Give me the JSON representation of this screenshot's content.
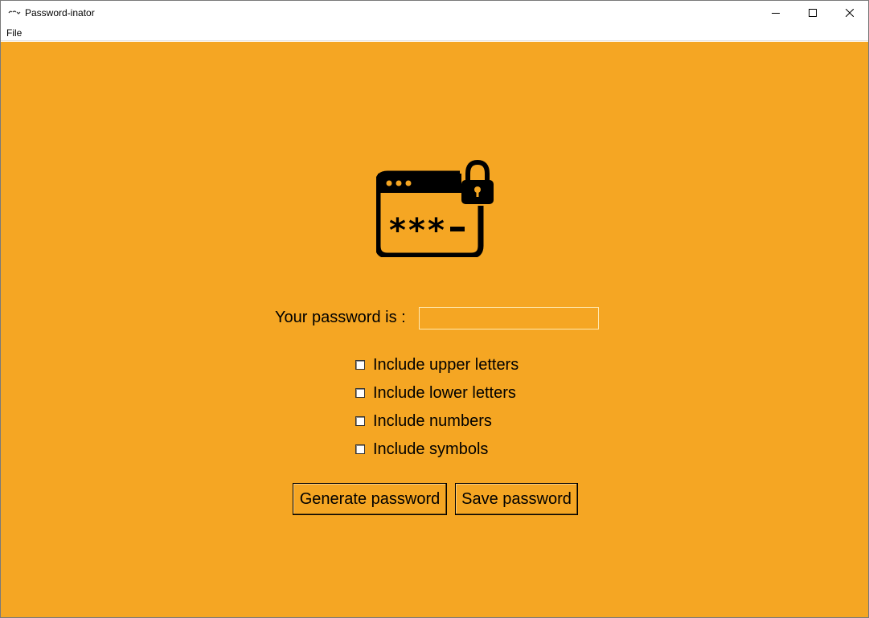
{
  "window": {
    "title": "Password-inator",
    "controls": {
      "minimize_icon": "minimize-icon",
      "maximize_icon": "maximize-icon",
      "close_icon": "close-icon"
    }
  },
  "menu": {
    "items": [
      {
        "label": "File"
      }
    ]
  },
  "main": {
    "background": "#f5a623",
    "hero_icon": "password-window-lock-icon",
    "password_label": "Your password is :",
    "password_value": "",
    "options": [
      {
        "label": "Include upper letters",
        "checked": false
      },
      {
        "label": "Include lower letters",
        "checked": false
      },
      {
        "label": "Include numbers",
        "checked": false
      },
      {
        "label": "Include symbols",
        "checked": false
      }
    ],
    "buttons": {
      "generate": "Generate password",
      "save": "Save password"
    }
  }
}
